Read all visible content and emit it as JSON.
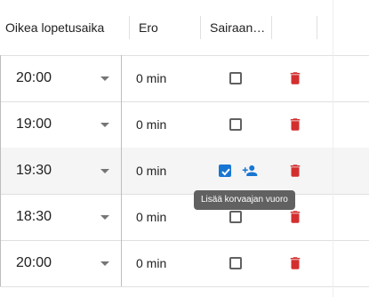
{
  "columns": {
    "end_time": "Oikea lopetusaika",
    "diff": "Ero",
    "sick": "Sairaan…"
  },
  "rows": [
    {
      "time": "20:00",
      "diff": "0 min",
      "sick": false
    },
    {
      "time": "19:00",
      "diff": "0 min",
      "sick": false
    },
    {
      "time": "19:30",
      "diff": "0 min",
      "sick": true,
      "highlighted": true
    },
    {
      "time": "18:30",
      "diff": "0 min",
      "sick": false
    },
    {
      "time": "20:00",
      "diff": "0 min",
      "sick": false
    }
  ],
  "tooltip": "Lisää korvaajan vuoro",
  "icons": {
    "dropdown": "chevron-down-icon",
    "checkbox": "checkbox-icon",
    "add_person": "person-add-icon",
    "delete": "trash-icon"
  },
  "colors": {
    "delete": "#d32f2f",
    "checked": "#1976d2",
    "add_person": "#1976d2",
    "tooltip_bg": "#616161"
  }
}
